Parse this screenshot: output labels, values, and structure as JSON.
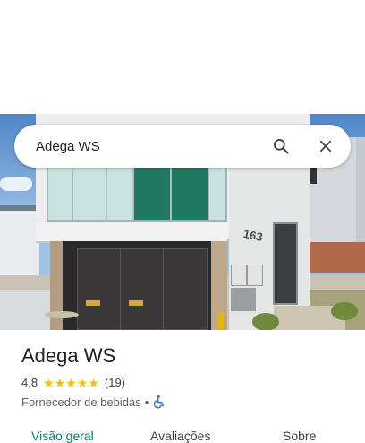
{
  "search": {
    "query": "Adega WS"
  },
  "place": {
    "name": "Adega WS",
    "rating": "4,8",
    "stars_filled": 5,
    "review_count": "(19)",
    "category": "Fornecedor de bebidas",
    "separator": "•",
    "accessibility_icon": "wheelchair-icon"
  },
  "photo": {
    "house_number": "163"
  },
  "tabs": [
    {
      "label": "Visão geral",
      "active": true
    },
    {
      "label": "Avaliações",
      "active": false
    },
    {
      "label": "Sobre",
      "active": false
    }
  ],
  "colors": {
    "accent": "#0b7a75",
    "star": "#fbbc04",
    "accessibility": "#1a73e8",
    "text_primary": "#202124",
    "text_secondary": "#5f6368"
  }
}
